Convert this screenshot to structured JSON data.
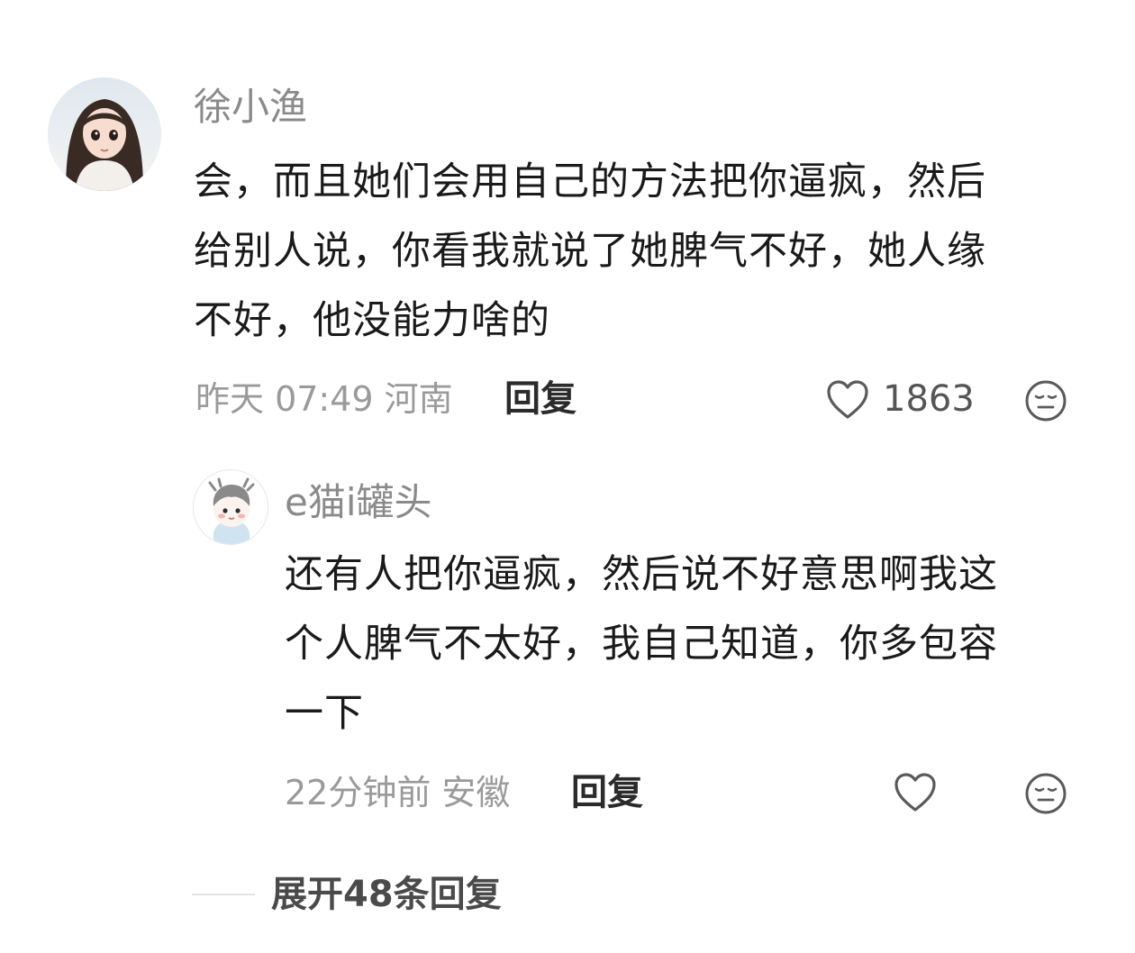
{
  "comment": {
    "username": "徐小渔",
    "lines": [
      "会，而且她们会用自己的方法把你逼疯，然后",
      "给别人说，你看我就说了她脾气不好，她人缘",
      "不好，他没能力啥的"
    ],
    "meta": "昨天 07:49 河南",
    "reply_label": "回复",
    "like_count": "1863",
    "avatar_icon": "girl-avatar",
    "like_icon": "heart-outline-icon",
    "dislike_icon": "meh-face-icon"
  },
  "reply": {
    "username": "e猫i罐头",
    "lines": [
      "还有人把你逼疯，然后说不好意思啊我这",
      "个人脾气不太好，我自己知道，你多包容",
      "一下"
    ],
    "meta": "22分钟前 安徽",
    "reply_label": "回复",
    "avatar_icon": "cartoon-kid-avatar",
    "like_icon": "heart-outline-icon",
    "dislike_icon": "meh-face-icon"
  },
  "expand_label": "展开48条回复",
  "colors": {
    "username": "#8a8a8a",
    "text": "#1a1a1a",
    "meta": "#9a9a9a",
    "reply": "#2b2b2b"
  }
}
